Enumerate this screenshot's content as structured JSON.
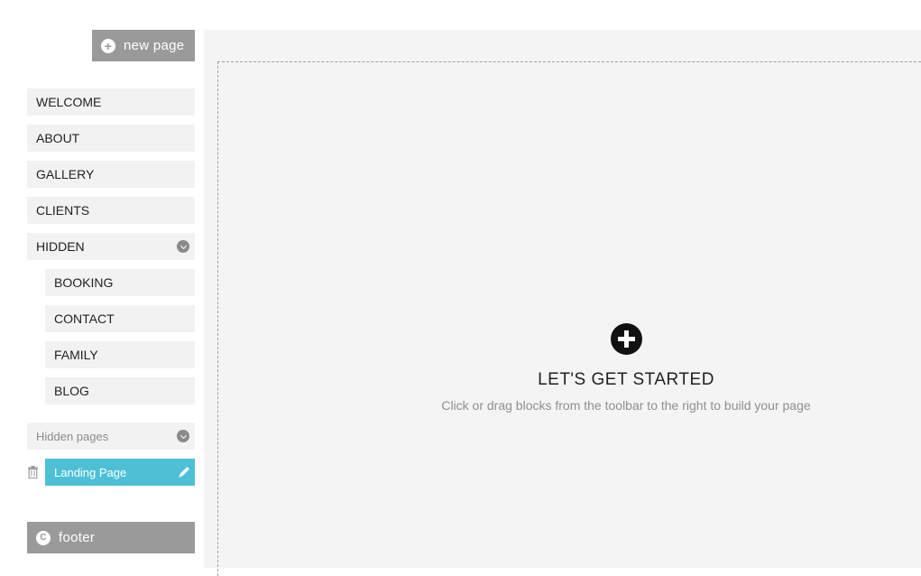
{
  "sidebar": {
    "new_page_label": "new page",
    "items": [
      {
        "label": "WELCOME"
      },
      {
        "label": "ABOUT"
      },
      {
        "label": "GALLERY"
      },
      {
        "label": "CLIENTS"
      },
      {
        "label": "HIDDEN"
      }
    ],
    "hidden_children": [
      {
        "label": "BOOKING"
      },
      {
        "label": "CONTACT"
      },
      {
        "label": "FAMILY"
      },
      {
        "label": "BLOG"
      }
    ],
    "hidden_pages_label": "Hidden pages",
    "landing_page_label": "Landing Page",
    "footer_label": "footer",
    "footer_icon_glyph": "C"
  },
  "canvas": {
    "title": "LET'S GET STARTED",
    "subtitle": "Click or drag blocks from the toolbar to the right to build your page"
  },
  "colors": {
    "accent": "#4dc0d6",
    "button_gray": "#9a9a9a",
    "item_bg": "#f2f2f2",
    "canvas_bg": "#f4f4f4"
  },
  "icons": {
    "new_page": "plus-circle-icon",
    "expand": "chevron-down-icon",
    "delete": "trash-icon",
    "edit": "pencil-icon",
    "footer": "copyright-icon",
    "start": "plus-circle-icon"
  }
}
